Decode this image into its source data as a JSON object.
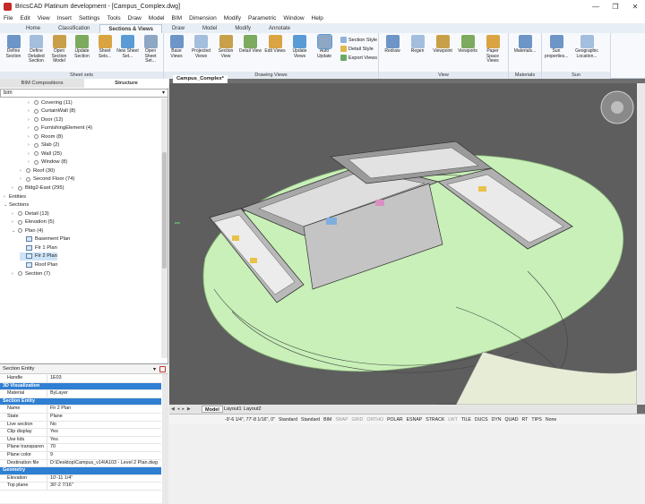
{
  "window": {
    "title": "BricsCAD Platinum development - [Campus_Complex.dwg]",
    "controls": [
      "—",
      "❐",
      "✕"
    ]
  },
  "menu": [
    "File",
    "Edit",
    "View",
    "Insert",
    "Settings",
    "Tools",
    "Draw",
    "Model",
    "BIM",
    "Dimension",
    "Modify",
    "Parametric",
    "Window",
    "Help"
  ],
  "ribbon_tabs": [
    "Home",
    "Classification",
    "Sections & Views",
    "Draw",
    "Model",
    "Modify",
    "Annotate"
  ],
  "ribbon_active_tab": "Sections & Views",
  "ribbon": {
    "sheet_sets": {
      "label": "Sheet sets",
      "buttons": [
        "Define Section",
        "Define Detailed Section",
        "Open Section Model",
        "Update Section",
        "Sheet Sets...",
        "New Sheet Set...",
        "Open Sheet Set..."
      ]
    },
    "drawing_views": {
      "label": "Drawing Views",
      "buttons": [
        "Base Views",
        "Projected Views",
        "Section View",
        "Detail View",
        "Edit Views",
        "Update Views",
        "Auto Update"
      ],
      "small": [
        "Section Style",
        "Detail Style",
        "Export Views"
      ]
    },
    "view": {
      "label": "View",
      "buttons": [
        "Redraw",
        "Regen",
        "Viewpoint",
        "Viewports",
        "Paper Space Views"
      ]
    },
    "materials": {
      "label": "Materials",
      "buttons": [
        "Materials..."
      ]
    },
    "sun": {
      "label": "Sun",
      "buttons": [
        "Sun properties...",
        "Geographic Location..."
      ]
    }
  },
  "left_panel": {
    "tabs": [
      "BIM Compositions",
      "Structure"
    ],
    "active_tab": "Structure",
    "dropdown": "bim",
    "tree": [
      {
        "label": "Covering (11)",
        "indent": 3,
        "icon": "circle",
        "toggle": "›"
      },
      {
        "label": "CurtainWall (8)",
        "indent": 3,
        "icon": "circle",
        "toggle": "›"
      },
      {
        "label": "Door (12)",
        "indent": 3,
        "icon": "circle",
        "toggle": "›"
      },
      {
        "label": "FurnishingElement (4)",
        "indent": 3,
        "icon": "circle",
        "toggle": "›"
      },
      {
        "label": "Room (8)",
        "indent": 3,
        "icon": "circle",
        "toggle": "›"
      },
      {
        "label": "Slab (2)",
        "indent": 3,
        "icon": "circle",
        "toggle": "›"
      },
      {
        "label": "Wall (25)",
        "indent": 3,
        "icon": "circle",
        "toggle": "›"
      },
      {
        "label": "Window (8)",
        "indent": 3,
        "icon": "circle",
        "toggle": "›"
      },
      {
        "label": "Roof (30)",
        "indent": 2,
        "icon": "circle",
        "toggle": "›"
      },
      {
        "label": "Second Floor (74)",
        "indent": 2,
        "icon": "circle",
        "toggle": "›"
      },
      {
        "label": "Bldg2-East (295)",
        "indent": 1,
        "icon": "circle",
        "toggle": "›"
      },
      {
        "label": "Entities",
        "indent": 0,
        "icon": "none",
        "toggle": "›"
      },
      {
        "label": "Sections",
        "indent": 0,
        "icon": "none",
        "toggle": "⌄"
      },
      {
        "label": "Detail (13)",
        "indent": 1,
        "icon": "circle",
        "toggle": "›"
      },
      {
        "label": "Elevation (5)",
        "indent": 1,
        "icon": "circle",
        "toggle": "›"
      },
      {
        "label": "Plan (4)",
        "indent": 1,
        "icon": "circle",
        "toggle": "⌄"
      },
      {
        "label": "Basement Plan",
        "indent": 2,
        "icon": "plan",
        "toggle": ""
      },
      {
        "label": "Flr 1 Plan",
        "indent": 2,
        "icon": "plan",
        "toggle": ""
      },
      {
        "label": "Flr 2 Plan",
        "indent": 2,
        "icon": "plan",
        "toggle": "",
        "selected": true
      },
      {
        "label": "Roof Plan",
        "indent": 2,
        "icon": "plan",
        "toggle": ""
      },
      {
        "label": "Section (7)",
        "indent": 1,
        "icon": "circle",
        "toggle": "›"
      }
    ]
  },
  "properties": {
    "title": "Section Entity",
    "rows": [
      {
        "k": "Handle",
        "v": "1E03"
      },
      {
        "section": "3D Visualization"
      },
      {
        "k": "Material",
        "v": "ByLayer"
      },
      {
        "section": "Section Entity"
      },
      {
        "k": "Name",
        "v": "Flr 2 Plan"
      },
      {
        "k": "State",
        "v": "Plane"
      },
      {
        "k": "Live section",
        "v": "No"
      },
      {
        "k": "Clip display",
        "v": "Yes"
      },
      {
        "k": "Use lids",
        "v": "Yes"
      },
      {
        "k": "Plane transparen",
        "v": "70"
      },
      {
        "k": "Plane color",
        "v": "9"
      },
      {
        "k": "Destination file",
        "v": "D:\\Desktop\\Campus_v14\\A103 - Level 2 Plan.dwg"
      },
      {
        "section": "Geometry"
      },
      {
        "k": "Elevation",
        "v": "10'-11 1/4\""
      },
      {
        "k": "Top plane",
        "v": "30'-2 7/16\""
      }
    ]
  },
  "document_tab": "Campus_Complex*",
  "layout_tabs": [
    "Model",
    "Layout1",
    "Layout2"
  ],
  "active_layout": "Model",
  "status": {
    "coords": "-9'-6 1/4\", 77'-8 1/16\", 0\"",
    "items": [
      {
        "t": "Standard",
        "on": true
      },
      {
        "t": "Standard",
        "on": true
      },
      {
        "t": "BIM",
        "on": true
      },
      {
        "t": "SNAP",
        "on": false
      },
      {
        "t": "GRID",
        "on": false
      },
      {
        "t": "ORTHO",
        "on": false
      },
      {
        "t": "POLAR",
        "on": true
      },
      {
        "t": "ESNAP",
        "on": true
      },
      {
        "t": "STRACK",
        "on": true
      },
      {
        "t": "LWT",
        "on": false
      },
      {
        "t": "TILE",
        "on": true
      },
      {
        "t": "DUCS",
        "on": true
      },
      {
        "t": "DYN",
        "on": true
      },
      {
        "t": "QUAD",
        "on": true
      },
      {
        "t": "RT",
        "on": true
      },
      {
        "t": "TIPS",
        "on": true
      },
      {
        "t": "None",
        "on": true
      }
    ]
  },
  "colors": {
    "accent": "#2f7fd3",
    "ground": "#c8f0b8",
    "viewport": "#5e5e5e"
  }
}
